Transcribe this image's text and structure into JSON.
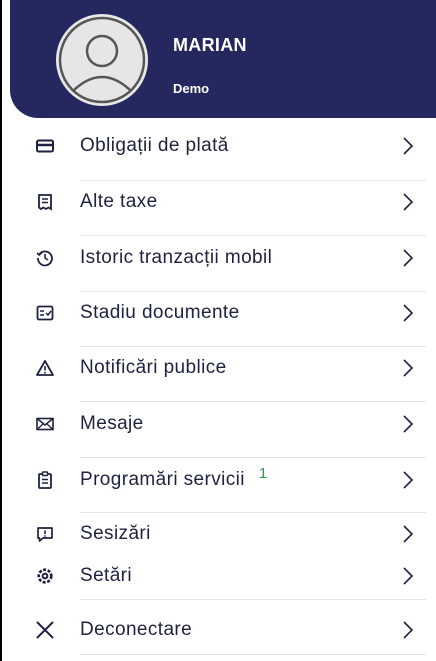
{
  "user": {
    "name": "MARIAN",
    "subtitle": "Demo"
  },
  "menu": {
    "items": [
      {
        "label": "Obligații de plată",
        "icon": "card-icon",
        "badge": ""
      },
      {
        "label": "Alte taxe",
        "icon": "receipt-icon",
        "badge": ""
      },
      {
        "label": "Istoric tranzacții mobil",
        "icon": "history-icon",
        "badge": ""
      },
      {
        "label": "Stadiu documente",
        "icon": "document-status-icon",
        "badge": ""
      },
      {
        "label": "Notificări publice",
        "icon": "warning-icon",
        "badge": ""
      },
      {
        "label": "Mesaje",
        "icon": "mail-icon",
        "badge": ""
      },
      {
        "label": "Programări servicii",
        "icon": "clipboard-icon",
        "badge": "1"
      },
      {
        "label": "Sesizări",
        "icon": "report-icon",
        "badge": ""
      },
      {
        "label": "Setări",
        "icon": "gear-icon",
        "badge": ""
      },
      {
        "label": "Deconectare",
        "icon": "close-icon",
        "badge": ""
      }
    ]
  },
  "colors": {
    "header_bg": "#25285f",
    "text": "#1e2240",
    "badge": "#1aa34a"
  }
}
